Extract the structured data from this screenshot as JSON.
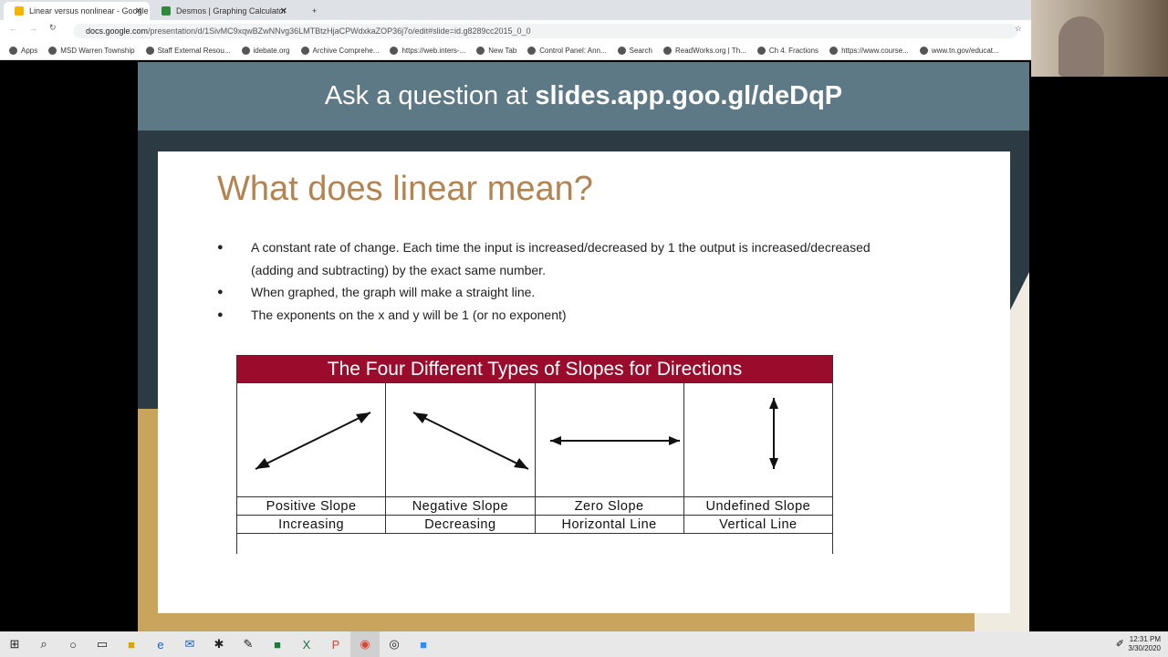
{
  "browser": {
    "tabs": [
      {
        "label": "Linear versus nonlinear - Google",
        "color": "#f4b400",
        "active": true
      },
      {
        "label": "Desmos | Graphing Calculator",
        "color": "#2f8a3e",
        "active": false
      }
    ],
    "url_host": "docs.google.com",
    "url_path": "/presentation/d/1SivMC9xqwBZwNNvg36LMTBtzHjaCPWdxkaZOP36j7o/edit#slide=id.g8289cc2015_0_0",
    "bookmarks": [
      "Apps",
      "MSD Warren Township",
      "Staff External Resou...",
      "idebate.org",
      "Archive Comprehe...",
      "https://web.inters-...",
      "New Tab",
      "Control Panel: Ann...",
      "Search",
      "ReadWorks.org | Th...",
      "Ch 4. Fractions",
      "https://www.course...",
      "www.tn.gov/educat..."
    ]
  },
  "slide_header": {
    "prefix": "Ask a question at ",
    "link": "slides.app.goo.gl/deDqP"
  },
  "slide": {
    "title": "What does linear mean?",
    "bullets": [
      "A constant rate of change.  Each time the input is increased/decreased by 1 the output is increased/decreased (adding and subtracting) by the exact same number.",
      "When graphed, the graph will make a straight line.",
      "The exponents on the x and y will be 1 (or no exponent)"
    ],
    "table": {
      "title": "The Four Different Types of Slopes for Directions",
      "header_color": "#9b0b2c",
      "slopes": [
        {
          "name": "Positive Slope",
          "desc": "Increasing",
          "icon": "arrow-up-right"
        },
        {
          "name": "Negative Slope",
          "desc": "Decreasing",
          "icon": "arrow-down-right"
        },
        {
          "name": "Zero Slope",
          "desc": "Horizontal Line",
          "icon": "arrow-horizontal"
        },
        {
          "name": "Undefined Slope",
          "desc": "Vertical Line",
          "icon": "arrow-vertical"
        }
      ]
    }
  },
  "taskbar": {
    "time": "12:31 PM",
    "date": "3/30/2020"
  }
}
